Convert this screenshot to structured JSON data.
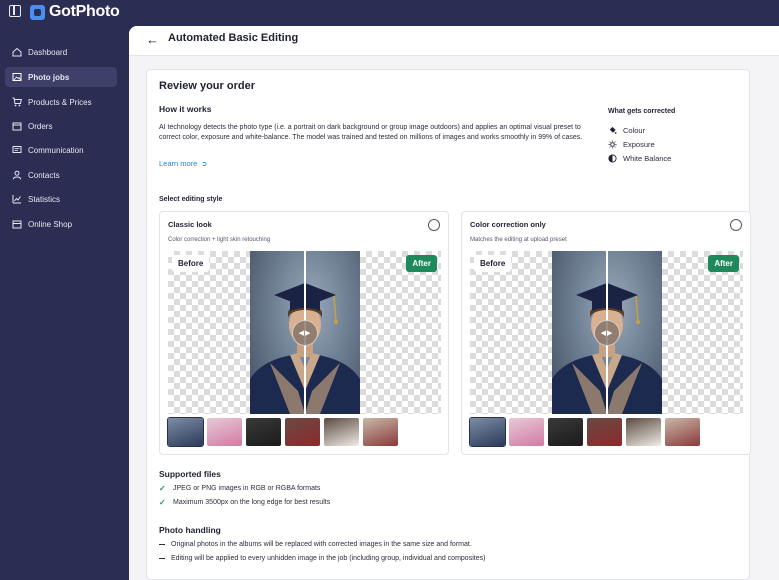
{
  "app": {
    "logo_text": "GotPhoto"
  },
  "sidebar": {
    "items": [
      {
        "label": "Dashboard",
        "icon": "home-icon"
      },
      {
        "label": "Photo jobs",
        "icon": "image-icon",
        "active": true
      },
      {
        "label": "Products & Prices",
        "icon": "cart-icon"
      },
      {
        "label": "Orders",
        "icon": "box-icon"
      },
      {
        "label": "Communication",
        "icon": "message-icon"
      },
      {
        "label": "Contacts",
        "icon": "user-icon"
      },
      {
        "label": "Statistics",
        "icon": "chart-icon"
      },
      {
        "label": "Online Shop",
        "icon": "store-icon"
      }
    ]
  },
  "header": {
    "title": "Automated Basic Editing"
  },
  "review": {
    "title": "Review your order",
    "how_title": "How it works",
    "how_text": "AI technology detects the photo type (i.e. a portrait on dark background or group image outdoors) and applies an optimal visual preset to correct color, exposure and white-balance. The model was trained and tested on millions of images and works smoothly in 99% of cases.",
    "learn_more": "Learn more"
  },
  "what_gets_corrected": {
    "title": "What gets corrected",
    "items": [
      "Colour",
      "Exposure",
      "White Balance"
    ]
  },
  "editing_style": {
    "title": "Select editing style",
    "options": [
      {
        "title": "Classic look",
        "subtitle": "Color correction + light skin retouching",
        "before": "Before",
        "after": "After"
      },
      {
        "title": "Color correction only",
        "subtitle": "Matches the editing at upload preset",
        "before": "Before",
        "after": "After"
      }
    ]
  },
  "supported_files": {
    "title": "Supported files",
    "items": [
      "JPEG or PNG images in RGB or RGBA formats",
      "Maximum 3500px on the long edge for best results"
    ]
  },
  "photo_handling": {
    "title": "Photo handling",
    "items": [
      "Original photos in the albums will be replaced with corrected images in the same size and format.",
      "Editing will be applied to every unhidden image in the job (including group, individual and composites)"
    ]
  },
  "colors": {
    "sidebar_bg": "#2b2d52",
    "accent_green": "#1e8a5b",
    "link_blue": "#2f7fd6",
    "check_green": "#1e9a65"
  }
}
